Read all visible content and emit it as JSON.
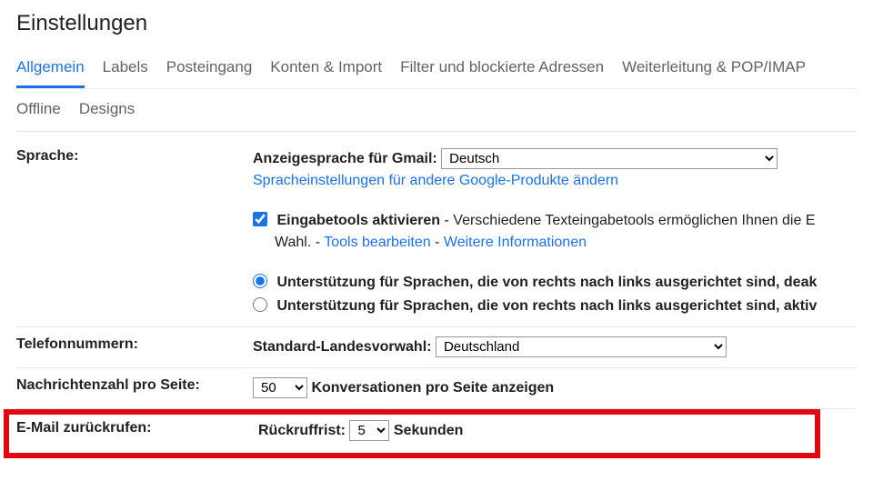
{
  "title": "Einstellungen",
  "tabs": {
    "allgemein": "Allgemein",
    "labels": "Labels",
    "posteingang": "Posteingang",
    "konten": "Konten & Import",
    "filter": "Filter und blockierte Adressen",
    "weiterleitung": "Weiterleitung & POP/IMAP",
    "offline": "Offline",
    "designs": "Designs"
  },
  "language": {
    "label": "Sprache:",
    "display_label": "Anzeigesprache für Gmail:",
    "selected": "Deutsch",
    "change_link": "Spracheinstellungen für andere Google-Produkte ändern",
    "input_tools_label": "Eingabetools aktivieren",
    "input_tools_desc": " - Verschiedene Texteingabetools ermöglichen Ihnen die E",
    "input_tools_wahl": "Wahl. - ",
    "tools_edit_link": "Tools bearbeiten",
    "sep": " - ",
    "more_info_link": "Weitere Informationen",
    "rtl_off": "Unterstützung für Sprachen, die von rechts nach links ausgerichtet sind, deak",
    "rtl_on": "Unterstützung für Sprachen, die von rechts nach links ausgerichtet sind, aktiv"
  },
  "phone": {
    "label": "Telefonnummern:",
    "prefix_label": "Standard-Landesvorwahl:",
    "selected": "Deutschland"
  },
  "pagesize": {
    "label": "Nachrichtenzahl pro Seite:",
    "value": "50",
    "suffix": "Konversationen pro Seite anzeigen"
  },
  "undo": {
    "label": "E-Mail zurückrufen:",
    "prefix": "Rückruffrist:",
    "value": "5",
    "suffix": "Sekunden"
  }
}
